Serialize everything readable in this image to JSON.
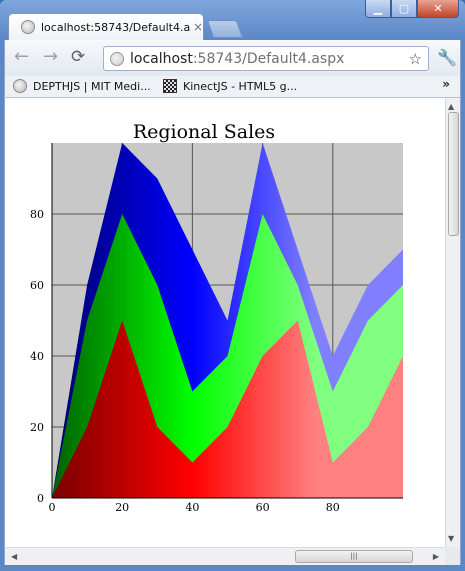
{
  "browser": {
    "tab_title": "localhost:58743/Default4.as",
    "tab_close": "×",
    "url_host": "localhost",
    "url_path": ":58743/Default4.aspx",
    "bookmarks": [
      {
        "label": "DEPTHJS | MIT Medi...",
        "icon": "globe-icon"
      },
      {
        "label": "KinectJS - HTML5 g...",
        "icon": "kinectjs-icon"
      }
    ],
    "more_glyph": "»",
    "window_buttons": {
      "minimize": "▁",
      "maximize": "▢",
      "close": "✕"
    }
  },
  "colors": {
    "window_chrome": "#5b87c7",
    "chart_background": "#c8c8c8",
    "series_1": "#0000ff",
    "series_2": "#00ff00",
    "series_3": "#ff0000"
  },
  "chart_data": {
    "type": "area",
    "title": "Regional Sales",
    "stacked": true,
    "x": [
      0,
      10,
      20,
      30,
      40,
      50,
      60,
      70,
      80,
      90,
      100
    ],
    "series": [
      {
        "values": [
          0,
          20,
          50,
          20,
          10,
          20,
          40,
          50,
          10,
          20,
          40
        ]
      },
      {
        "values": [
          0,
          30,
          30,
          40,
          20,
          20,
          40,
          10,
          20,
          30,
          20
        ]
      },
      {
        "values": [
          0,
          10,
          20,
          30,
          40,
          10,
          20,
          10,
          10,
          10,
          10
        ]
      }
    ],
    "x_ticks": [
      "0",
      "20",
      "40",
      "60",
      "80"
    ],
    "y_ticks": [
      "0",
      "20",
      "40",
      "60",
      "80"
    ],
    "xlim": [
      0,
      100
    ],
    "ylim": [
      0,
      100
    ],
    "grid": true
  }
}
